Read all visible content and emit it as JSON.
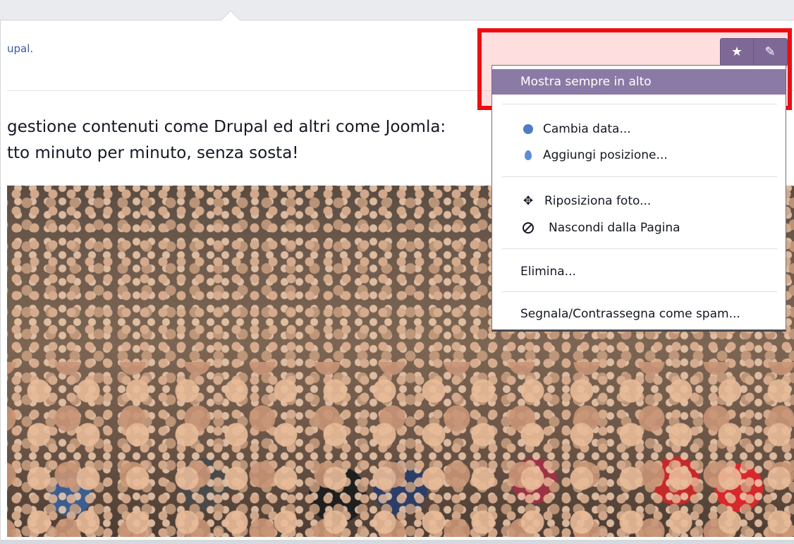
{
  "header": {
    "link_text": "upal."
  },
  "post": {
    "line1": "gestione contenuti come Drupal ed altri come Joomla:",
    "line2": "tto minuto per minuto, senza sosta!"
  },
  "toolbar": {
    "star_icon": "★",
    "pencil_icon": "✎"
  },
  "menu": {
    "items": [
      {
        "label": "Mostra sempre in alto",
        "icon": ""
      },
      {
        "label": "Cambia data...",
        "icon": "clock-icon"
      },
      {
        "label": "Aggiungi posizione...",
        "icon": "location-pin-icon"
      },
      {
        "label": "Riposiziona foto...",
        "icon": "move-arrows-icon"
      },
      {
        "label": "Nascondi dalla Pagina",
        "icon": "hide-icon"
      },
      {
        "label": "Elimina...",
        "icon": ""
      },
      {
        "label": "Segnala/Contrassegna come spam...",
        "icon": ""
      }
    ]
  },
  "colors": {
    "highlight_border": "#ee0d10",
    "menu_selected": "#8b7aa5",
    "link": "#3b5998"
  }
}
